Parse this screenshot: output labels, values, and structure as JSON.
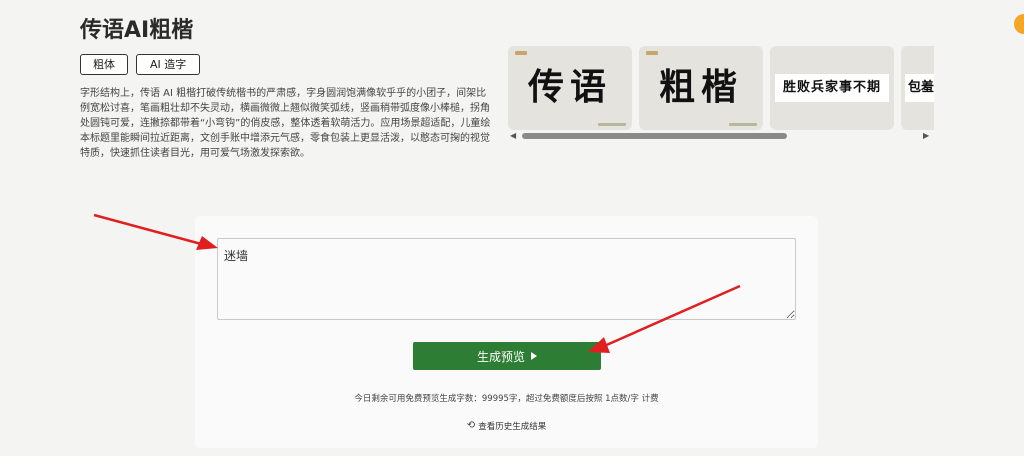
{
  "page": {
    "title": "传语AI粗楷",
    "tags": [
      "粗体",
      "AI 造字"
    ],
    "description": "字形结构上，传语 AI 粗楷打破传统楷书的严肃感，字身圆润饱满像软乎乎的小团子，间架比例宽松讨喜，笔画粗壮却不失灵动，横画微微上翘似微笑弧线，竖画稍带弧度像小棒槌，拐角处圆钝可爱，连撇捺都带着“小弯钩”的俏皮感，整体透着软萌活力。应用场景超适配，儿童绘本标题里能瞬间拉近距离，文创手账中增添元气感，零食包装上更显活泼，以憨态可掬的视觉特质，快速抓住读者目光，用可爱气场激发探索欲。"
  },
  "gallery": {
    "cards": [
      "传语",
      "粗楷",
      "胜败兵家事不期",
      "包羞"
    ]
  },
  "form": {
    "input_value": "迷墙",
    "generate_label": "生成预览",
    "quota_text": "今日剩余可用免费预览生成字数：99995字，超过免费额度后按照 1点数/字 计费",
    "history_label": "查看历史生成结果"
  },
  "colors": {
    "primary_green": "#2e7d34",
    "annotation_red": "#e02020",
    "accent_orange": "#f5a623"
  },
  "icons": {
    "generate": "play-icon",
    "history": "history-icon",
    "scroll_left": "chevron-left-icon",
    "scroll_right": "chevron-right-icon"
  }
}
